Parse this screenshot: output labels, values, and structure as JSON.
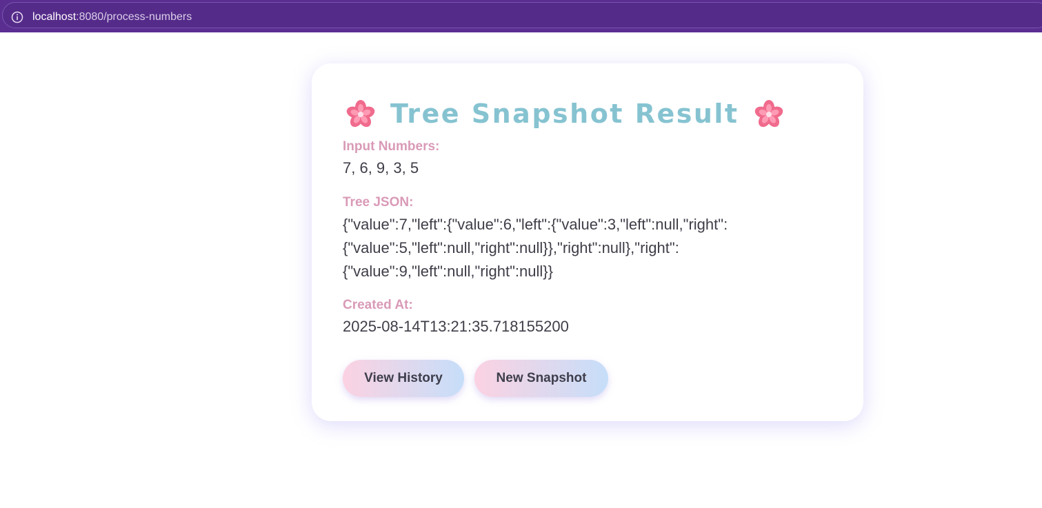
{
  "browser": {
    "url_host": "localhost",
    "url_rest": ":8080/process-numbers"
  },
  "card": {
    "title": "Tree Snapshot Result",
    "icons": [
      "cherry-blossom-icon",
      "cherry-blossom-icon"
    ],
    "input_label": "Input Numbers:",
    "input_value": "7, 6, 9, 3, 5",
    "json_label": "Tree JSON:",
    "json_lines": [
      "{\"value\":7,\"left\":{\"value\":6,\"left\":{\"value\":3,\"left\":null,\"right\":",
      "{\"value\":5,\"left\":null,\"right\":null}},\"right\":null},\"right\":",
      "{\"value\":9,\"left\":null,\"right\":null}}"
    ],
    "created_label": "Created At:",
    "created_value": "2025-08-14T13:21:35.718155200",
    "buttons": {
      "history": "View History",
      "new": "New Snapshot"
    }
  },
  "colors": {
    "browser_bar": "#5a2d91",
    "title": "#86c3d1",
    "label": "#d99ab7",
    "button_gradient_start": "#fbd2e2",
    "button_gradient_end": "#c6def9"
  }
}
